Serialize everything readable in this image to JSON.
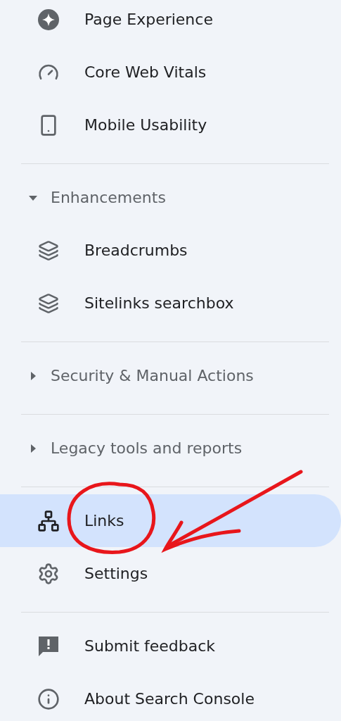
{
  "sections": [
    {
      "items": [
        {
          "label": "Page Experience",
          "kind": "sparkle",
          "selected": false
        },
        {
          "label": "Core Web Vitals",
          "kind": "gauge",
          "selected": false
        },
        {
          "label": "Mobile Usability",
          "kind": "phone",
          "selected": false
        }
      ]
    },
    {
      "header": {
        "label": "Enhancements",
        "expanded": true
      },
      "items": [
        {
          "label": "Breadcrumbs",
          "kind": "layers",
          "selected": false
        },
        {
          "label": "Sitelinks searchbox",
          "kind": "layers",
          "selected": false
        }
      ]
    },
    {
      "header": {
        "label": "Security & Manual Actions",
        "expanded": false
      }
    },
    {
      "header": {
        "label": "Legacy tools and reports",
        "expanded": false
      }
    },
    {
      "items": [
        {
          "label": "Links",
          "kind": "network",
          "selected": true
        },
        {
          "label": "Settings",
          "kind": "gear",
          "selected": false
        }
      ]
    },
    {
      "items": [
        {
          "label": "Submit feedback",
          "kind": "feedback",
          "selected": false
        },
        {
          "label": "About Search Console",
          "kind": "info",
          "selected": false
        }
      ]
    }
  ]
}
